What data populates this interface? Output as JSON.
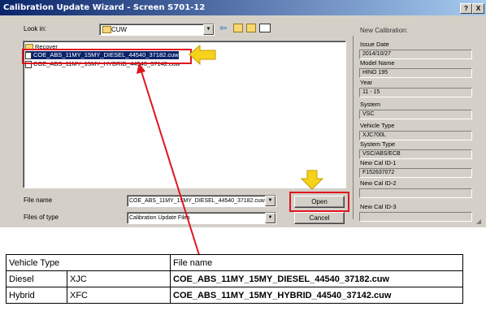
{
  "window": {
    "title": "Calibration Update Wizard - Screen S701-12",
    "help_btn": "?",
    "close_btn": "X"
  },
  "dialog": {
    "look_in_label": "Look in:",
    "look_in_value": "CUW",
    "files": [
      {
        "name": "Recover",
        "type": "folder"
      },
      {
        "name": "COE_ABS_11MY_15MY_DIESEL_44540_37182.cuw",
        "type": "file",
        "selected": true
      },
      {
        "name": "COE_ABS_11MY_15MY_HYBRID_44540_37142.cuw",
        "type": "file"
      }
    ],
    "file_name_label": "File name",
    "file_name_value": "COE_ABS_11MY_15MY_DIESEL_44540_37182.cuw",
    "files_of_type_label": "Files of type",
    "files_of_type_value": "Calibration Update Files",
    "open_label": "Open",
    "cancel_label": "Cancel"
  },
  "new_calibration": {
    "title": "New Calibration:",
    "fields": [
      {
        "label": "Issue Date",
        "value": "2014/10/27"
      },
      {
        "label": "Model Name",
        "value": "HINO 195"
      },
      {
        "label": "Year",
        "value": "11 - 15"
      },
      {
        "label": "System",
        "value": "VSC"
      },
      {
        "label": "Vehicle Type",
        "value": "XJC700L"
      },
      {
        "label": "System Type",
        "value": "VSC/ABS/ECB"
      },
      {
        "label": "New Cal ID-1",
        "value": "F152637072"
      },
      {
        "label": "New Cal ID-2",
        "value": ""
      },
      {
        "label": "New Cal ID-3",
        "value": ""
      }
    ]
  },
  "table": {
    "headers": [
      "Vehicle Type",
      "File name"
    ],
    "rows": [
      {
        "type": "Diesel",
        "code": "XJC",
        "file": "COE_ABS_11MY_15MY_DIESEL_44540_37182.cuw"
      },
      {
        "type": "Hybrid",
        "code": "XFC",
        "file": "COE_ABS_11MY_15MY_HYBRID_44540_37142.cuw"
      }
    ]
  },
  "colors": {
    "titlebar": "#0a246a",
    "selection": "#0a246a",
    "annotation_red": "#e0141e",
    "annotation_arrow": "#f7d21b"
  }
}
